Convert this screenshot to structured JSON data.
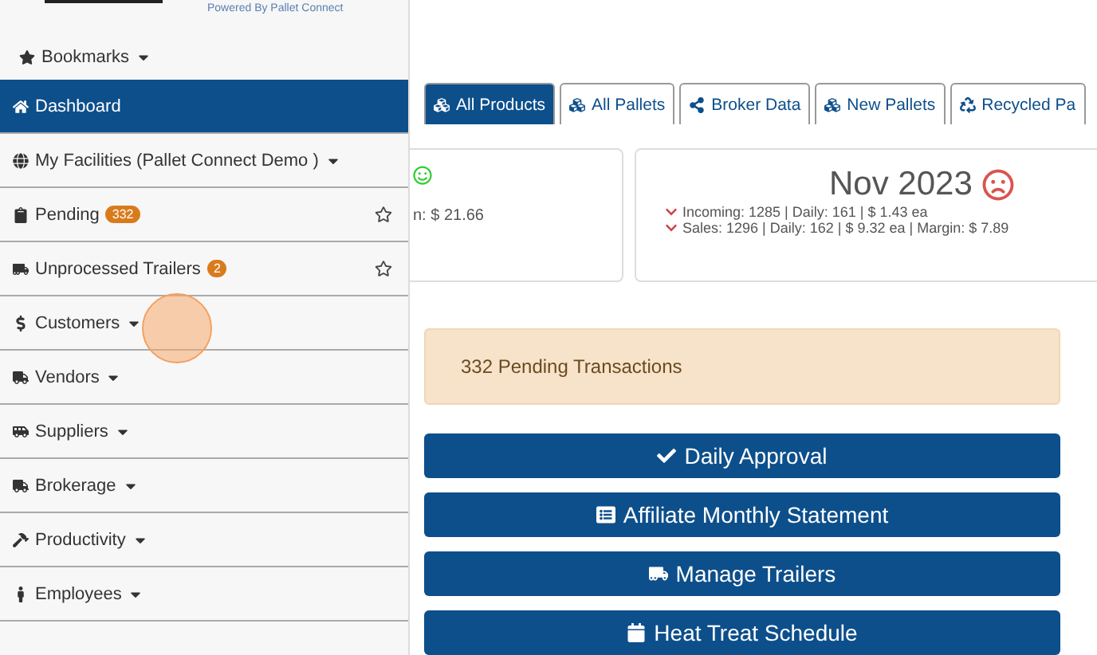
{
  "header": {
    "tagline": "Powered By Pallet Connect"
  },
  "bookmarks": {
    "label": "Bookmarks"
  },
  "sidebar": {
    "items": [
      {
        "label": "Dashboard",
        "selected": true,
        "caret": false
      },
      {
        "label": "My Facilities (Pallet Connect Demo )",
        "selected": false,
        "caret": true
      },
      {
        "label": "Pending",
        "selected": false,
        "caret": false,
        "badge": "332",
        "starred": false
      },
      {
        "label": "Unprocessed Trailers",
        "selected": false,
        "caret": false,
        "badge": "2",
        "starred": false
      },
      {
        "label": "Customers",
        "selected": false,
        "caret": true
      },
      {
        "label": "Vendors",
        "selected": false,
        "caret": true
      },
      {
        "label": "Suppliers",
        "selected": false,
        "caret": true
      },
      {
        "label": "Brokerage",
        "selected": false,
        "caret": true
      },
      {
        "label": "Productivity",
        "selected": false,
        "caret": true
      },
      {
        "label": "Employees",
        "selected": false,
        "caret": true
      }
    ]
  },
  "tabs": [
    {
      "label": "All Products",
      "selected": true
    },
    {
      "label": "All Pallets",
      "selected": false
    },
    {
      "label": "Broker Data",
      "selected": false
    },
    {
      "label": "New Pallets",
      "selected": false
    },
    {
      "label": "Recycled Pa",
      "selected": false
    }
  ],
  "cards": [
    {
      "kind": "partial",
      "happy": true,
      "lines": [
        "n: $ 21.66"
      ]
    },
    {
      "kind": "month",
      "title": "Nov 2023",
      "happy": false,
      "lines": [
        "Incoming: 1285 | Daily: 161 | $ 1.43 ea",
        "Sales: 1296 | Daily: 162 | $ 9.32 ea | Margin: $ 7.89"
      ]
    }
  ],
  "alert": {
    "text": "332 Pending Transactions"
  },
  "actions": [
    "Daily Approval",
    "Affiliate Monthly Statement",
    "Manage Trailers",
    "Heat Treat Schedule"
  ]
}
